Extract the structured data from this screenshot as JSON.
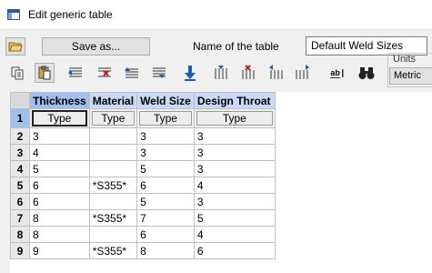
{
  "window": {
    "title": "Edit generic table"
  },
  "top": {
    "save_as_label": "Save as...",
    "name_label": "Name of the table",
    "name_value": "Default Weld Sizes"
  },
  "units": {
    "label": "Units",
    "value": "Metric"
  },
  "table": {
    "columns": [
      "Thickness",
      "Material",
      "Weld Size",
      "Design Throat"
    ],
    "type_label": "Type",
    "rows": [
      {
        "num": "1"
      },
      {
        "num": "2",
        "cells": [
          "3",
          "",
          "3",
          "3"
        ]
      },
      {
        "num": "3",
        "cells": [
          "4",
          "",
          "3",
          "3"
        ]
      },
      {
        "num": "4",
        "cells": [
          "5",
          "",
          "5",
          "3"
        ]
      },
      {
        "num": "5",
        "cells": [
          "6",
          "*S355*",
          "6",
          "4"
        ]
      },
      {
        "num": "6",
        "cells": [
          "6",
          "",
          "5",
          "3"
        ]
      },
      {
        "num": "7",
        "cells": [
          "8",
          "*S355*",
          "7",
          "5"
        ]
      },
      {
        "num": "8",
        "cells": [
          "8",
          "",
          "6",
          "4"
        ]
      },
      {
        "num": "9",
        "cells": [
          "9",
          "*S355*",
          "8",
          "6"
        ]
      }
    ]
  },
  "toolbar": {
    "find_glyph": "♜♜",
    "abc_glyph": "ab"
  }
}
